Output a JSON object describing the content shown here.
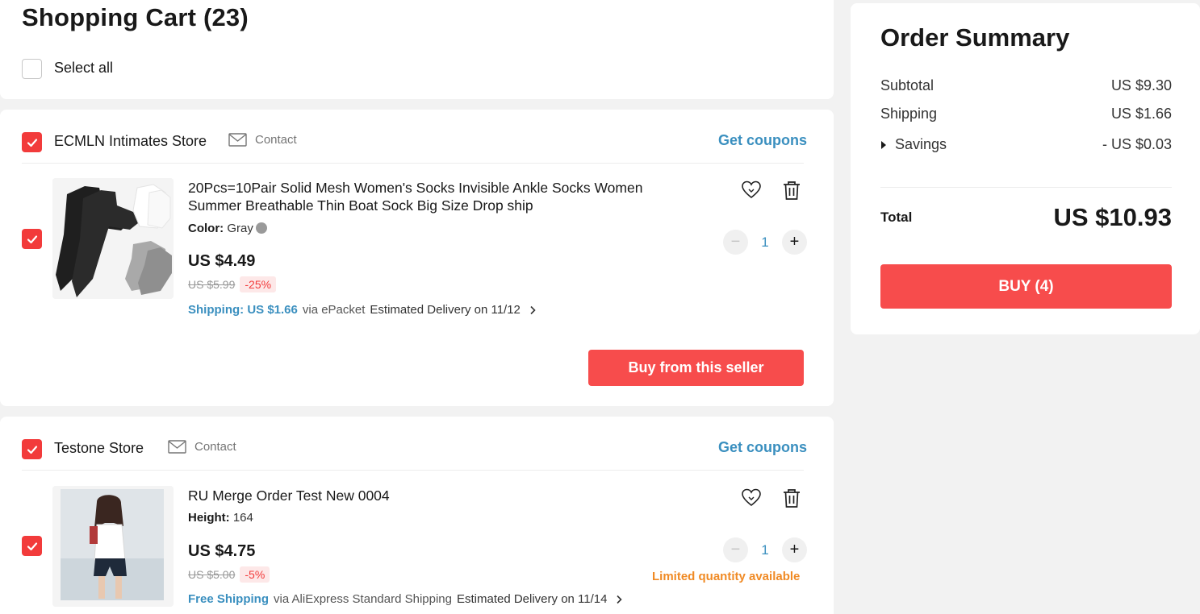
{
  "cart": {
    "title": "Shopping Cart (23)",
    "select_all_label": "Select all"
  },
  "stores": [
    {
      "name": "ECMLN Intimates Store",
      "contact_label": "Contact",
      "coupons_label": "Get coupons",
      "checked": true,
      "item": {
        "checked": true,
        "title": "20Pcs=10Pair Solid Mesh Women's Socks Invisible Ankle Socks Women Summer Breathable Thin Boat Sock Big Size Drop ship",
        "attr_name": "Color:",
        "attr_value": "Gray",
        "price": "US $4.49",
        "orig_price": "US $5.99",
        "discount": "-25%",
        "shipping_label": "Shipping: US $1.66",
        "shipping_via": "via ePacket",
        "delivery": "Estimated Delivery on 11/12",
        "quantity": "1"
      },
      "buy_button": "Buy from this seller"
    },
    {
      "name": "Testone Store",
      "contact_label": "Contact",
      "coupons_label": "Get coupons",
      "checked": true,
      "item": {
        "checked": true,
        "title": "RU Merge Order Test New 0004",
        "attr_name": "Height:",
        "attr_value": "164",
        "price": "US $4.75",
        "orig_price": "US $5.00",
        "discount": "-5%",
        "shipping_label": "Free Shipping",
        "shipping_via": "via AliExpress Standard Shipping",
        "delivery": "Estimated Delivery on 11/14",
        "quantity": "1",
        "stock_note": "Limited quantity available"
      }
    }
  ],
  "summary": {
    "title": "Order Summary",
    "subtotal_label": "Subtotal",
    "subtotal_value": "US $9.30",
    "shipping_label": "Shipping",
    "shipping_value": "US $1.66",
    "savings_label": "Savings",
    "savings_value": "- US $0.03",
    "total_label": "Total",
    "total_value": "US $10.93",
    "buy_label": "BUY (4)"
  },
  "colors": {
    "accent_red": "#f74c4c",
    "link_blue": "#3a8fbf",
    "warning_orange": "#f08a24"
  }
}
